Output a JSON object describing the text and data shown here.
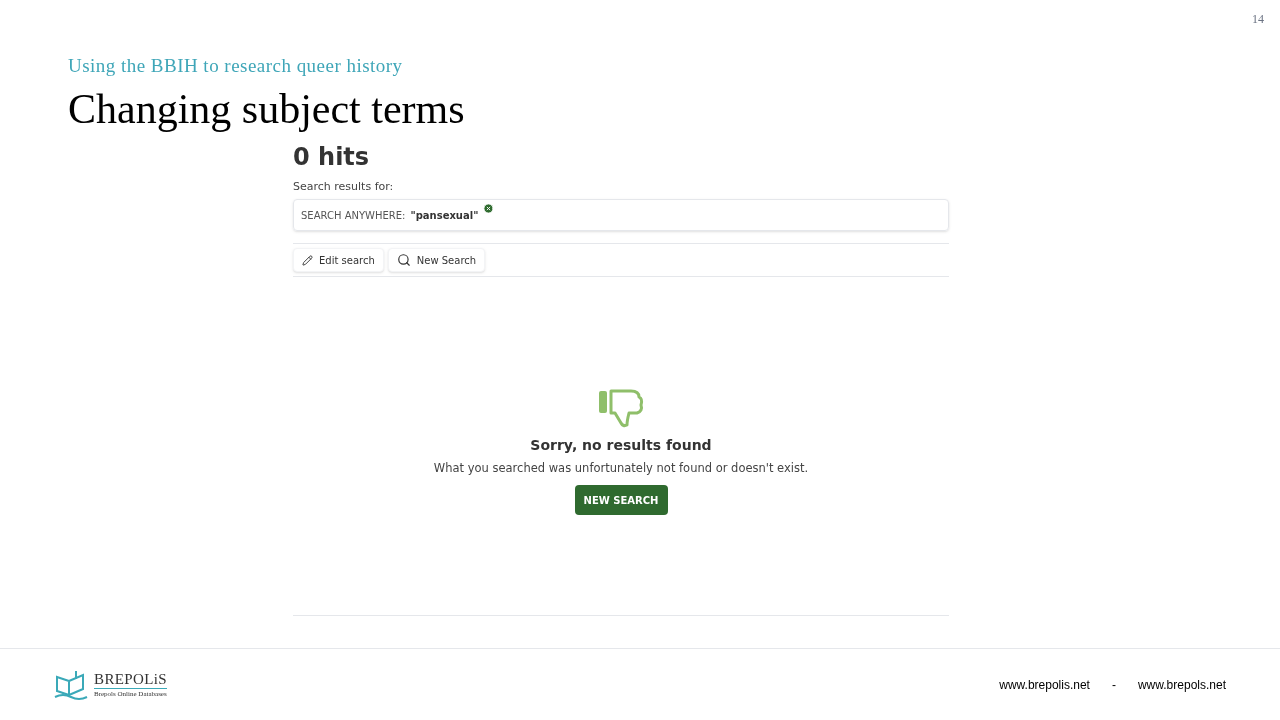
{
  "slide": {
    "number": "14",
    "subtitle": "Using the BBIH to research queer history",
    "title": "Changing subject terms"
  },
  "results": {
    "hits": "0 hits",
    "label": "Search results for:",
    "filter": {
      "field": "SEARCH ANYWHERE:",
      "term": "\"pansexual\""
    },
    "actions": [
      {
        "kind": "edit",
        "label": "Edit search"
      },
      {
        "kind": "search",
        "label": "New Search"
      }
    ],
    "empty": {
      "heading": "Sorry, no results found",
      "message": "What you searched was unfortunately not found or doesn't exist.",
      "button": "NEW SEARCH"
    }
  },
  "footer": {
    "brand": "BREPOLiS",
    "tagline": "Brepols Online Databases",
    "links": [
      "www.brepolis.net",
      "-",
      "www.brepols.net"
    ]
  }
}
